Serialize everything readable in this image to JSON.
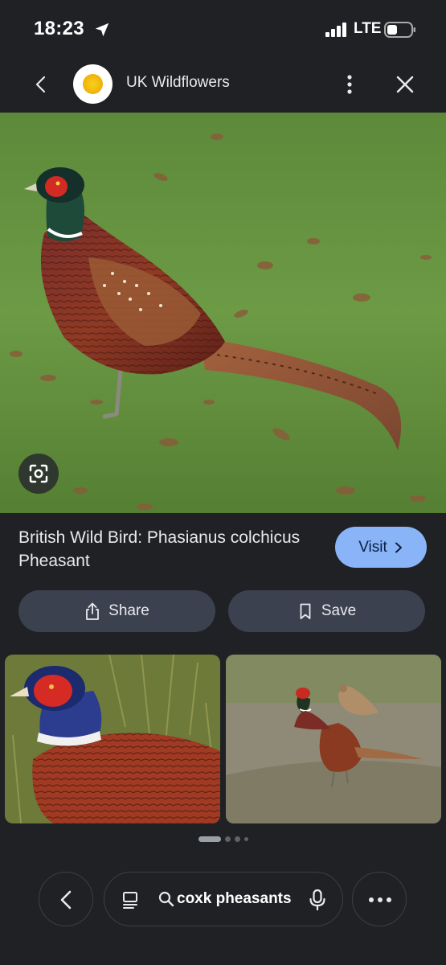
{
  "status_bar": {
    "time": "18:23",
    "network": "LTE",
    "icons": [
      "location-arrow-icon",
      "signal-icon",
      "battery-icon"
    ]
  },
  "header": {
    "site_name": "UK Wildflowers",
    "icons": [
      "back-arrow-icon",
      "site-logo",
      "more-vert-icon",
      "close-icon"
    ]
  },
  "result": {
    "title": "British Wild Bird: Phasianus colchicus Pheasant",
    "visit_label": "Visit",
    "share_label": "Share",
    "save_label": "Save",
    "accent_color": "#8ab4f8"
  },
  "related_images": {
    "count": 2,
    "pagination": {
      "pages": 4,
      "current": 1
    }
  },
  "bottom_bar": {
    "search_query": "coxk pheasants",
    "icons": [
      "back-icon",
      "tabs-icon",
      "search-icon",
      "mic-icon",
      "more-horiz-icon"
    ]
  }
}
